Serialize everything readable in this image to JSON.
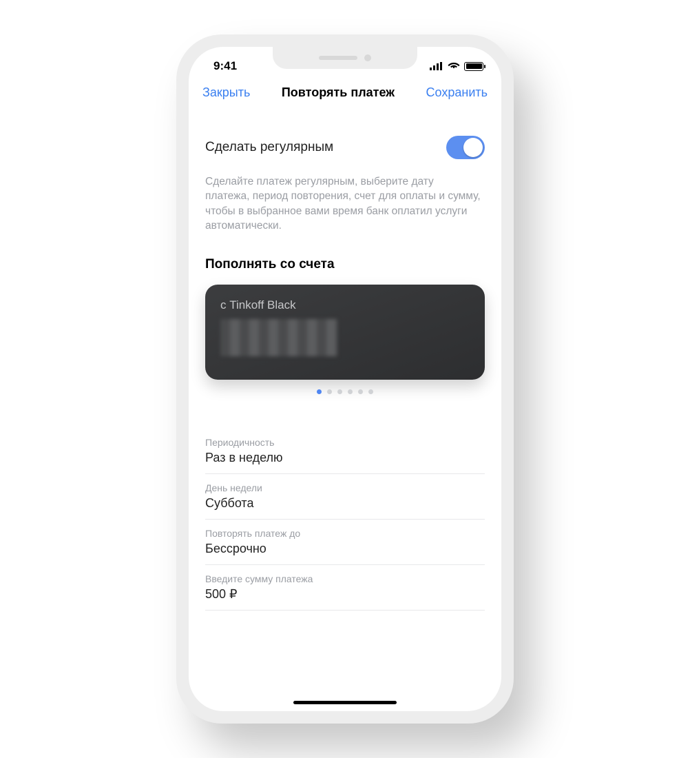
{
  "status_bar": {
    "time": "9:41"
  },
  "nav": {
    "close_label": "Закрыть",
    "title": "Повторять платеж",
    "save_label": "Сохранить"
  },
  "regular": {
    "toggle_label": "Сделать регулярным",
    "toggle_on": true,
    "description": "Сделайте платеж регулярным, выберите дату платежа, период повторения, счет для оплаты и сумму, чтобы в выбранное вами время банк оплатил услуги автоматически."
  },
  "account": {
    "section_title": "Пополнять со счета",
    "card_title": "с Tinkoff Black",
    "page_index": 0,
    "page_count": 6
  },
  "fields": [
    {
      "label": "Периодичность",
      "value": "Раз в неделю"
    },
    {
      "label": "День недели",
      "value": "Суббота"
    },
    {
      "label": "Повторять платеж до",
      "value": "Бессрочно"
    },
    {
      "label": "Введите сумму платежа",
      "value": "500 ₽"
    }
  ],
  "colors": {
    "accent": "#3A7FF0"
  }
}
